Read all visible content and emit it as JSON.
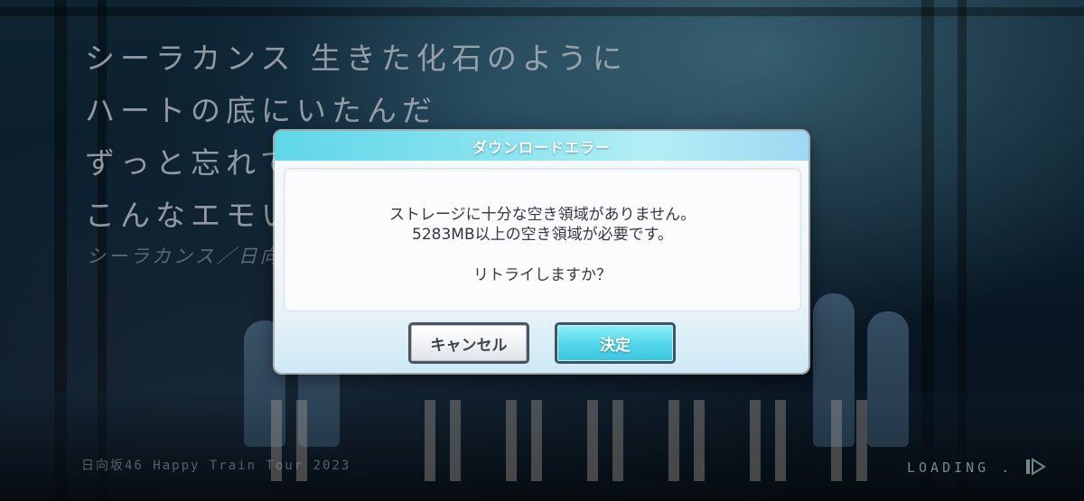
{
  "lyrics": {
    "lines": [
      "シーラカンス 生きた化石のように",
      "ハートの底にいたんだ",
      "ずっと忘れて",
      "こんなエモい"
    ],
    "credit": "シーラカンス／日向"
  },
  "footer": {
    "tour_title": "日向坂46 Happy Train Tour 2023",
    "loading_label": "LOADING ."
  },
  "dialog": {
    "title": "ダウンロードエラー",
    "message_line1": "ストレージに十分な空き領域がありません。",
    "message_line2": "5283MB以上の空き領域が必要です。",
    "message_line3": "リトライしますか？",
    "cancel_label": "キャンセル",
    "confirm_label": "決定"
  },
  "colors": {
    "header_accent": "#5fd7e8",
    "confirm_button": "#55d8ea",
    "loading_text": "#aacdc3"
  },
  "icons": {
    "loading": "loading-spinner-icon"
  }
}
